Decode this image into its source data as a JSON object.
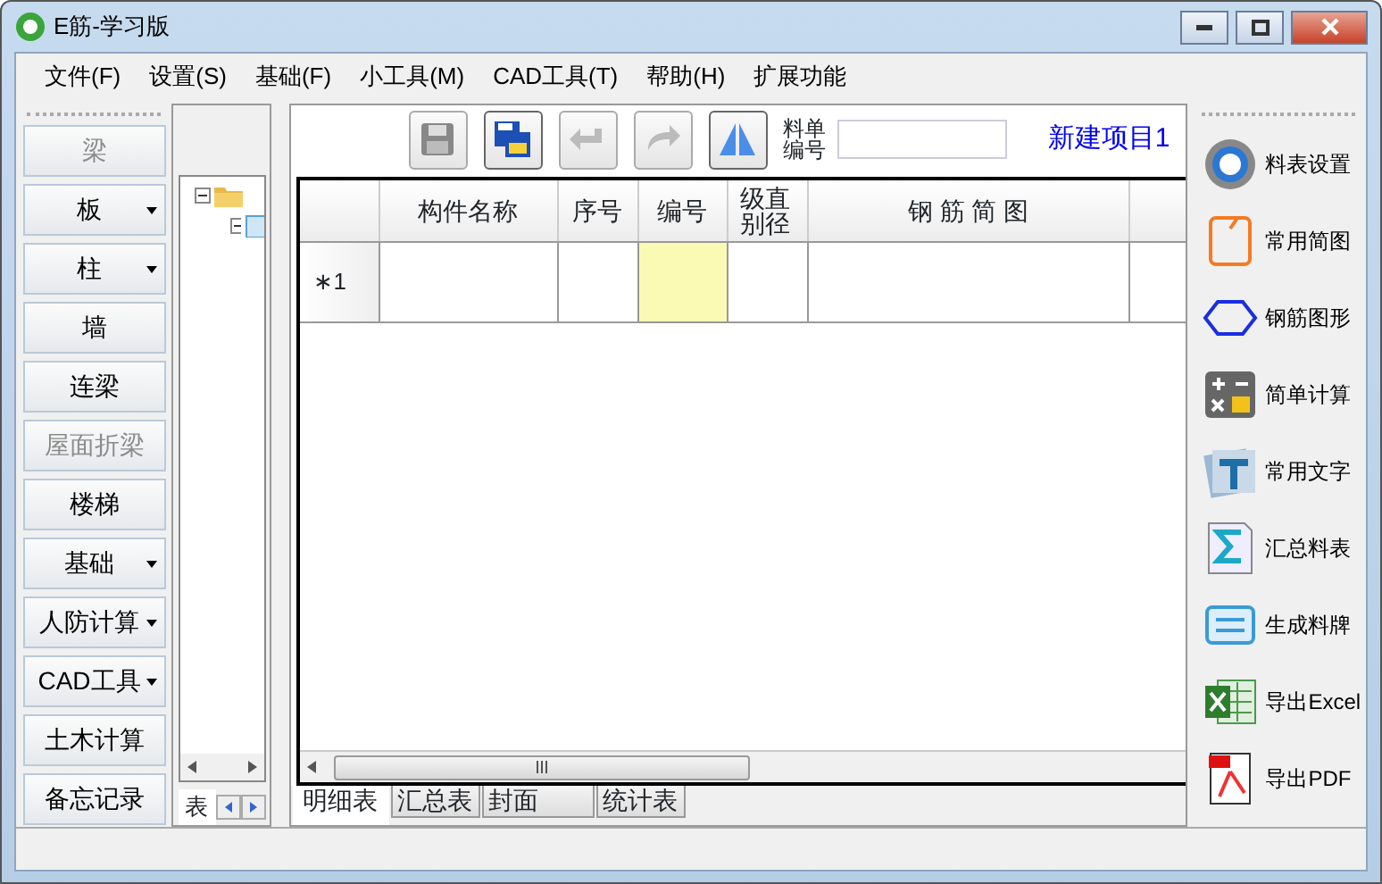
{
  "window": {
    "title": "E筋-学习版"
  },
  "menu": [
    "文件(F)",
    "设置(S)",
    "基础(F)",
    "小工具(M)",
    "CAD工具(T)",
    "帮助(H)",
    "扩展功能"
  ],
  "sidebar": [
    {
      "label": "梁",
      "disabled": true,
      "dropdown": false
    },
    {
      "label": "板",
      "disabled": false,
      "dropdown": true
    },
    {
      "label": "柱",
      "disabled": false,
      "dropdown": true
    },
    {
      "label": "墙",
      "disabled": false,
      "dropdown": false
    },
    {
      "label": "连梁",
      "disabled": false,
      "dropdown": false
    },
    {
      "label": "屋面折梁",
      "disabled": true,
      "dropdown": false
    },
    {
      "label": "楼梯",
      "disabled": false,
      "dropdown": false
    },
    {
      "label": "基础",
      "disabled": false,
      "dropdown": true
    },
    {
      "label": "人防计算",
      "disabled": false,
      "dropdown": true
    },
    {
      "label": "CAD工具",
      "disabled": false,
      "dropdown": true
    },
    {
      "label": "土木计算",
      "disabled": false,
      "dropdown": false
    },
    {
      "label": "备忘记录",
      "disabled": false,
      "dropdown": false
    }
  ],
  "tree": [
    {
      "kind": "folder",
      "expanded": true,
      "children": [
        {
          "kind": "sheet",
          "expanded": true
        }
      ]
    }
  ],
  "tree_tab": "表",
  "toolbar": [
    {
      "kind": "save",
      "disabled": true
    },
    {
      "kind": "save-all",
      "disabled": false
    },
    {
      "kind": "undo",
      "disabled": true
    },
    {
      "kind": "redo",
      "disabled": true
    },
    {
      "kind": "mirror",
      "disabled": false
    }
  ],
  "list_number": {
    "label": "料单编号"
  },
  "project_name": "新建项目1",
  "table": {
    "columns": [
      "",
      "构件名称",
      "序号",
      "编号",
      "级直别径",
      "钢 筋 简 图",
      ""
    ],
    "rows": [
      {
        "header": "∗1",
        "cells": [
          {
            "current": false
          },
          {
            "current": false
          },
          {
            "current": true
          },
          {
            "current": false
          },
          {
            "current": false
          }
        ]
      }
    ]
  },
  "sheet_tabs": [
    {
      "label": "明细表",
      "selected": true
    },
    {
      "label": "汇总表",
      "selected": false
    },
    {
      "label": "封面",
      "selected": false
    },
    {
      "label": "统计表",
      "selected": false
    }
  ],
  "tools": [
    {
      "kind": "gear",
      "label": "料表设置"
    },
    {
      "kind": "sketch",
      "label": "常用简图"
    },
    {
      "kind": "shape",
      "label": "钢筋图形"
    },
    {
      "kind": "calc",
      "label": "简单计算"
    },
    {
      "kind": "text",
      "label": "常用文字"
    },
    {
      "kind": "sum",
      "label": "汇总料表"
    },
    {
      "kind": "tag",
      "label": "生成料牌"
    },
    {
      "kind": "excel",
      "label": "导出Excel"
    },
    {
      "kind": "pdf",
      "label": "导出PDF"
    }
  ]
}
